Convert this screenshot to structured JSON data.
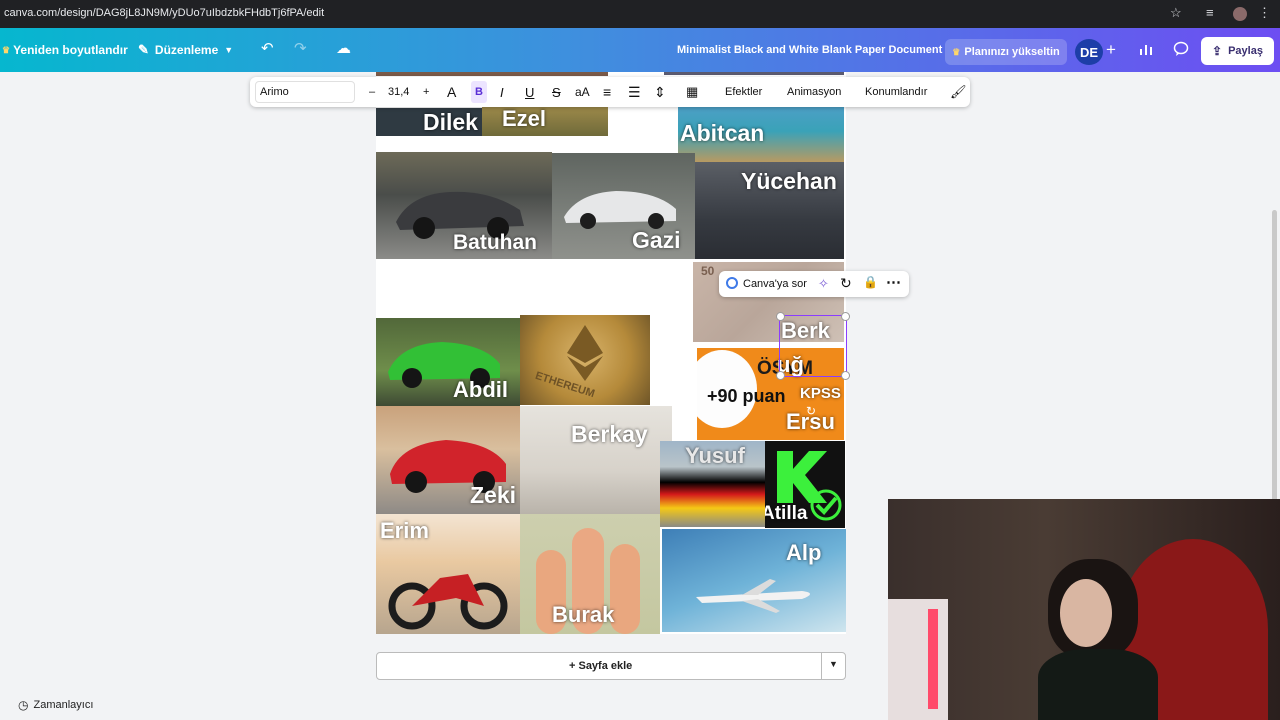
{
  "browser": {
    "url": "canva.com/design/DAG8jL8JN9M/yDUo7uIbdzbkFHdbTj6fPA/edit"
  },
  "header": {
    "resize_label": "Yeniden boyutlandır",
    "edit_label": "Düzenleme",
    "doc_title": "Minimalist Black and White Blank Paper Document",
    "upgrade_label": "Planınızı yükseltin",
    "avatar_initials": "DE",
    "share_label": "Paylaş",
    "colors": {
      "gradient_start": "#06b7cf",
      "gradient_end": "#6d4ef2"
    }
  },
  "text_toolbar": {
    "font": "Arimo",
    "size": "31,4",
    "effects_label": "Efektler",
    "animation_label": "Animasyon",
    "position_label": "Konumlandır"
  },
  "mini_toolbar": {
    "ask_label": "Canva'ya sor"
  },
  "collage": {
    "dilek": "Dilek",
    "ezel": "Ezel",
    "abitcan": "Abitcan",
    "batuhan": "Batuhan",
    "gazi": "Gazi",
    "yucehan": "Yücehan",
    "abdil": "Abdil",
    "ethereum": "ETHEREUM",
    "berkay_sel": "Berk",
    "ugur_sel": "uğ",
    "osym": "ÖSYM",
    "puan": "+90 puan",
    "kpss": "KPSS",
    "ersu": "Ersu",
    "zeki": "Zeki",
    "berkay": "Berkay",
    "yusuf": "Yusuf",
    "atilla": "Atilla",
    "erim": "Erim",
    "burak": "Burak",
    "alp": "Alp",
    "fifty": "50"
  },
  "footer": {
    "add_page_label": "+ Sayfa ekle",
    "timer_label": "Zamanlayıcı"
  }
}
